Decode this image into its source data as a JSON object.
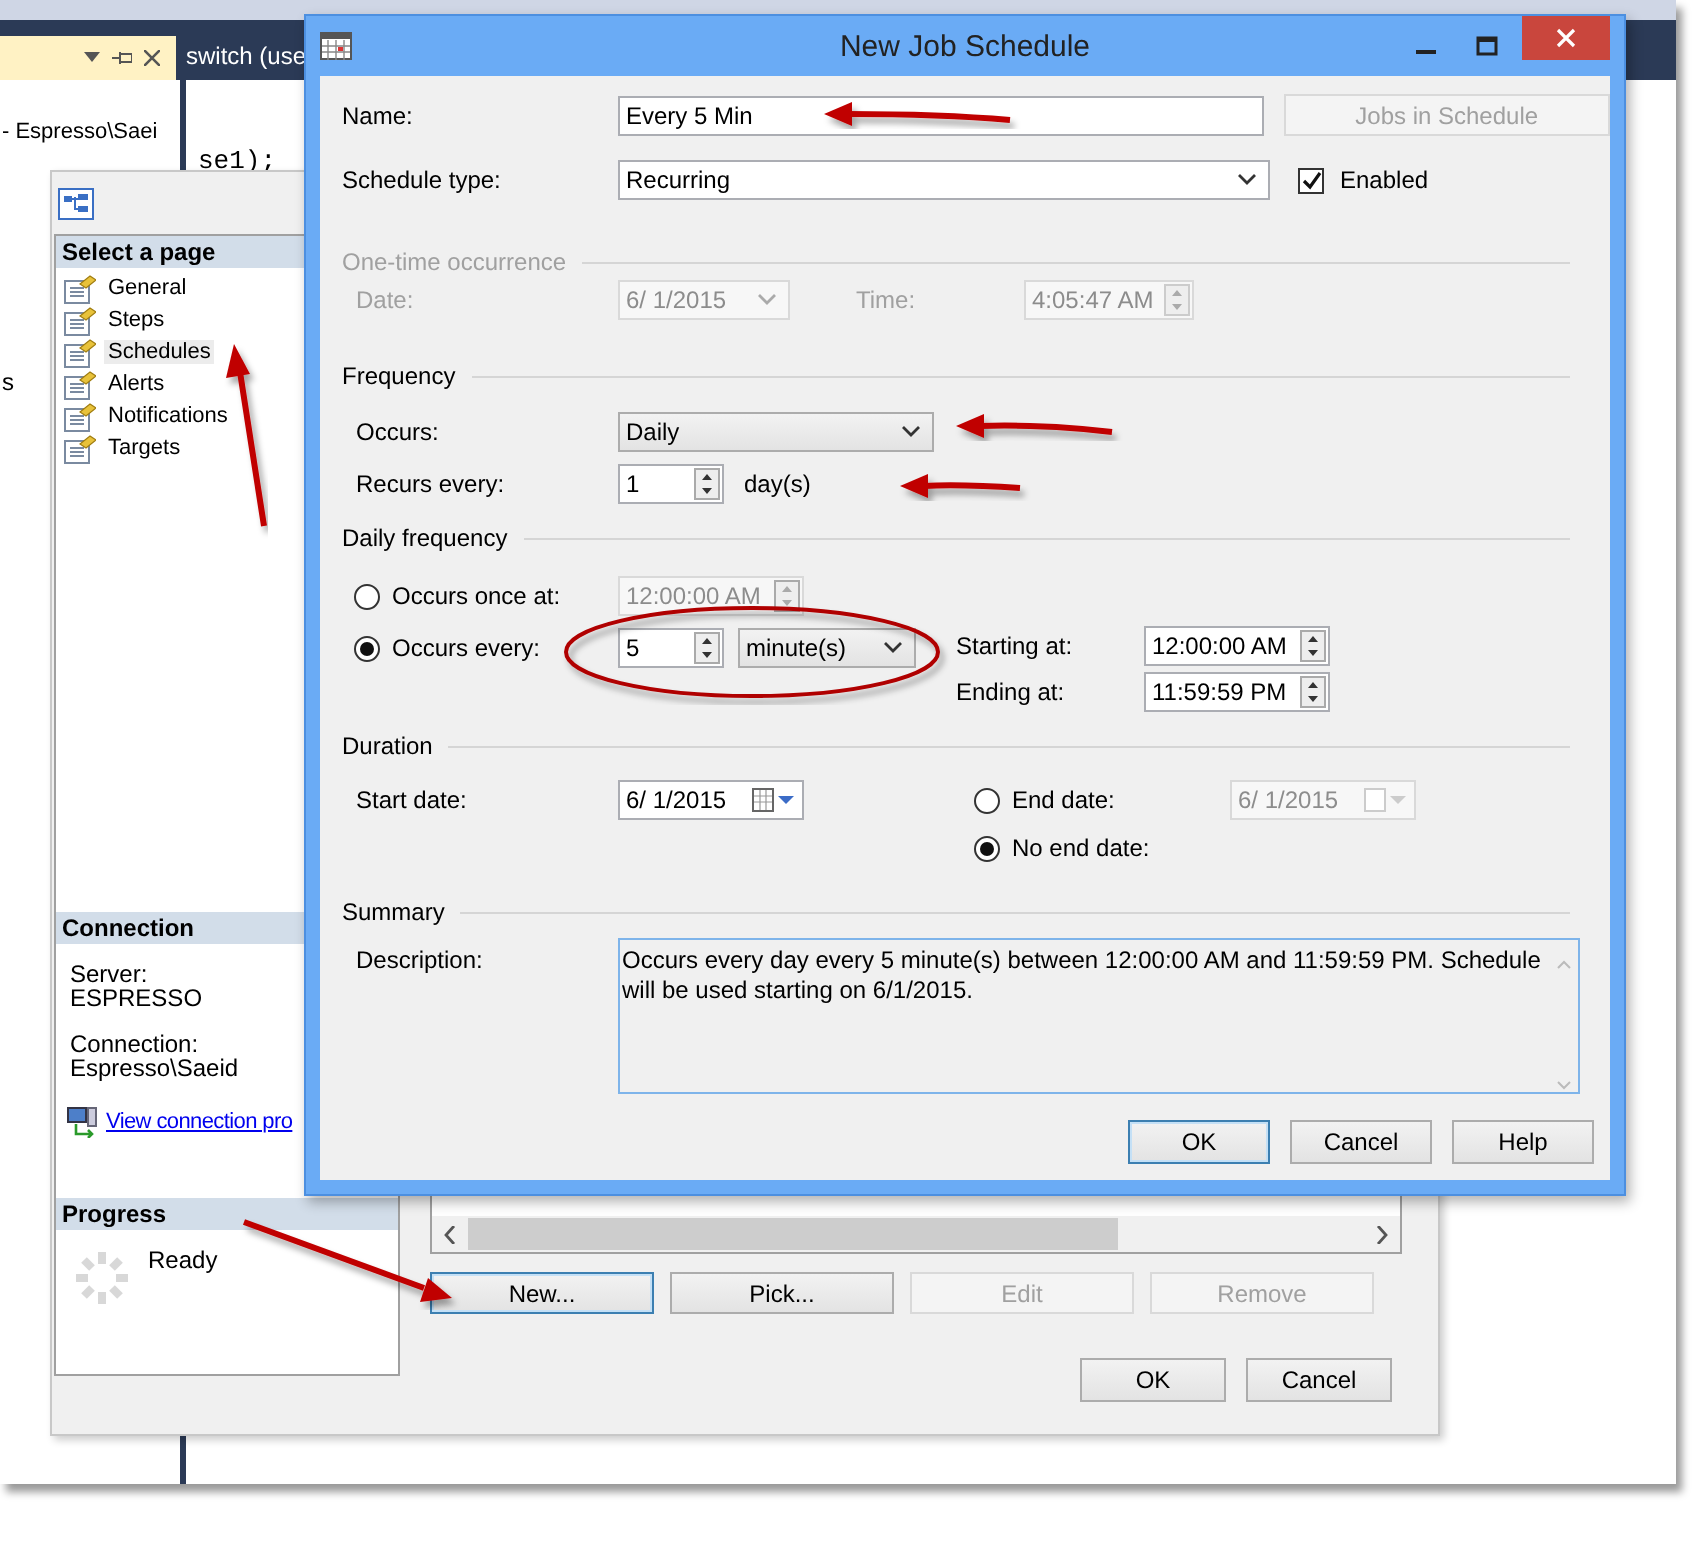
{
  "ide": {
    "tab_label": "switch (use",
    "explorer_text": "- Espresso\\Saei",
    "code_text": "se1);",
    "edge_text": "s"
  },
  "job_properties": {
    "select_page_header": "Select a page",
    "pages": [
      {
        "label": "General",
        "selected": false
      },
      {
        "label": "Steps",
        "selected": false
      },
      {
        "label": "Schedules",
        "selected": true
      },
      {
        "label": "Alerts",
        "selected": false
      },
      {
        "label": "Notifications",
        "selected": false
      },
      {
        "label": "Targets",
        "selected": false
      }
    ],
    "connection_header": "Connection",
    "server_label": "Server:",
    "server": "ESPRESSO",
    "connection_label": "Connection:",
    "connection": "Espresso\\Saeid",
    "view_link": "View connection pro",
    "progress_header": "Progress",
    "progress_status": "Ready",
    "list_buttons": [
      {
        "label": "New...",
        "disabled": false,
        "focused": true
      },
      {
        "label": "Pick...",
        "disabled": false,
        "focused": false
      },
      {
        "label": "Edit",
        "disabled": true,
        "focused": false
      },
      {
        "label": "Remove",
        "disabled": true,
        "focused": false
      }
    ],
    "dialog_buttons": [
      {
        "label": "OK"
      },
      {
        "label": "Cancel"
      }
    ]
  },
  "schedule_dialog": {
    "title": "New Job Schedule",
    "name": {
      "label": "Name:",
      "value": "Every 5 Min"
    },
    "jobs_button": {
      "label": "Jobs in Schedule",
      "disabled": true
    },
    "schedule_type": {
      "label": "Schedule type:",
      "value": "Recurring"
    },
    "enabled": {
      "label": "Enabled",
      "checked": true
    },
    "one_time": {
      "title": "One-time occurrence",
      "disabled": true,
      "date_label": "Date:",
      "date": "6/  1/2015",
      "time_label": "Time:",
      "time": "4:05:47 AM"
    },
    "frequency": {
      "title": "Frequency",
      "occurs_label": "Occurs:",
      "occurs": "Daily",
      "recurs_label": "Recurs every:",
      "recurs": "1",
      "unit": "day(s)"
    },
    "daily_frequency": {
      "title": "Daily frequency",
      "options": [
        {
          "label": "Occurs once at:",
          "selected": false,
          "value": "12:00:00 AM"
        },
        {
          "label": "Occurs every:",
          "selected": true,
          "value": "5",
          "unit": "minute(s)"
        }
      ],
      "starting_label": "Starting at:",
      "starting": "12:00:00 AM",
      "ending_label": "Ending at:",
      "ending": "11:59:59 PM"
    },
    "duration": {
      "title": "Duration",
      "start_label": "Start date:",
      "start": "6/  1/2015",
      "end_options": [
        {
          "label": "End date:",
          "selected": false,
          "value": "6/  1/2015"
        },
        {
          "label": "No end date:",
          "selected": true
        }
      ]
    },
    "summary": {
      "title": "Summary",
      "description_label": "Description:",
      "description": "Occurs every day every 5 minute(s) between 12:00:00 AM and 11:59:59 PM. Schedule will be used starting on 6/1/2015."
    },
    "buttons": [
      {
        "label": "OK",
        "focused": true
      },
      {
        "label": "Cancel",
        "focused": false
      },
      {
        "label": "Help",
        "focused": false
      }
    ]
  }
}
